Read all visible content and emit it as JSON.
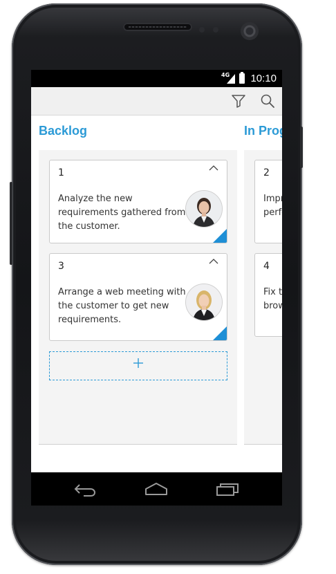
{
  "status_bar": {
    "time": "10:10",
    "network": "4G"
  },
  "toolbar": {
    "icons": [
      "filter-icon",
      "search-icon"
    ]
  },
  "columns": [
    {
      "title": "Backlog",
      "cards": [
        {
          "id": "1",
          "text": "Analyze the new requirements gathered from the customer."
        },
        {
          "id": "3",
          "text": "Arrange a web meeting with the customer to get new requirements."
        }
      ],
      "add_card_icon": "plus-icon"
    },
    {
      "title": "In Progress",
      "cards": [
        {
          "id": "2",
          "text": "Improve application performance"
        },
        {
          "id": "4",
          "text": "Fix the issues reported in IE browser."
        }
      ]
    }
  ],
  "nav_bar": {
    "icons": [
      "back-icon",
      "home-icon",
      "recent-apps-icon"
    ]
  },
  "colors": {
    "accent": "#2b9ad6",
    "column_bg": "#f4f4f4",
    "corner": "#1e8fd6"
  }
}
